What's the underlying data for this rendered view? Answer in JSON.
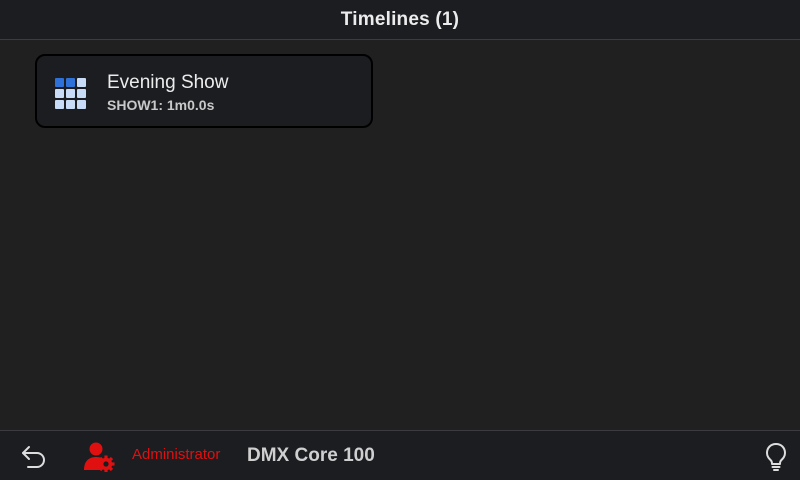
{
  "header": {
    "title": "Timelines (1)"
  },
  "timelines": [
    {
      "name": "Evening Show",
      "detail": "SHOW1: 1m0.0s",
      "icon": "timeline-grid-icon"
    }
  ],
  "footer": {
    "back_icon": "undo-arrow-icon",
    "user_icon": "user-gear-icon",
    "user_role": "Administrator",
    "device": "DMX Core 100",
    "help_icon": "lightbulb-icon"
  },
  "colors": {
    "background": "#202020",
    "bar": "#1b1d21",
    "accent_blue": "#2e72d9",
    "light_blue": "#c9dcf7",
    "alert_red": "#e01010"
  }
}
